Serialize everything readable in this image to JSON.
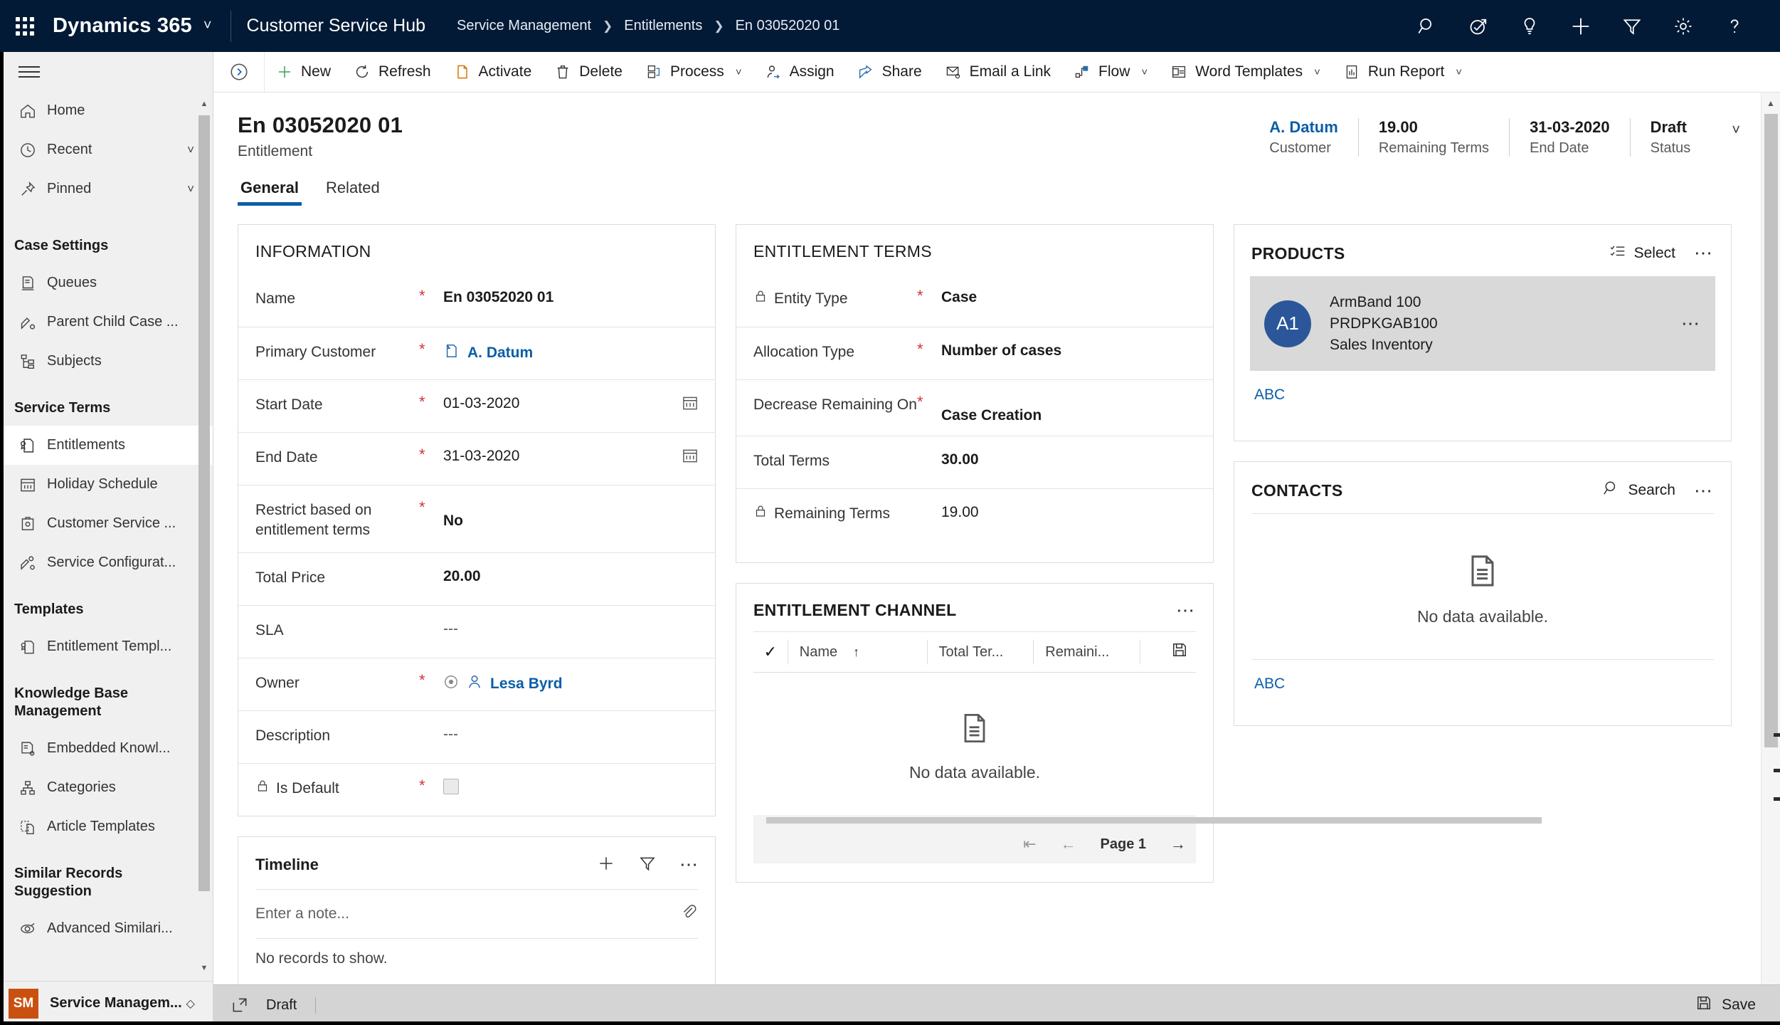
{
  "topbar": {
    "waffle": "app-launcher",
    "brand": "Dynamics 365",
    "app_title": "Customer Service Hub",
    "breadcrumb": [
      "Service Management",
      "Entitlements",
      "En 03052020 01"
    ],
    "icons": [
      "search-icon",
      "assistant-icon",
      "lightbulb-icon",
      "plus-icon",
      "filter-icon",
      "gear-icon",
      "help-icon"
    ],
    "brand_bg": "#021A36"
  },
  "sidebar": {
    "top_items": [
      {
        "label": "Home",
        "icon": "home-icon",
        "chevron": false
      },
      {
        "label": "Recent",
        "icon": "clock-icon",
        "chevron": true
      },
      {
        "label": "Pinned",
        "icon": "pin-icon",
        "chevron": true
      }
    ],
    "groups": [
      {
        "title": "Case Settings",
        "items": [
          {
            "label": "Queues",
            "icon": "queue-icon"
          },
          {
            "label": "Parent Child Case ...",
            "icon": "parent-child-case-icon"
          },
          {
            "label": "Subjects",
            "icon": "subjects-icon"
          }
        ]
      },
      {
        "title": "Service Terms",
        "items": [
          {
            "label": "Entitlements",
            "icon": "entitlement-icon",
            "active": true
          },
          {
            "label": "Holiday Schedule",
            "icon": "calendar-icon"
          },
          {
            "label": "Customer Service ...",
            "icon": "customer-service-icon"
          },
          {
            "label": "Service Configurat...",
            "icon": "service-config-icon"
          }
        ]
      },
      {
        "title": "Templates",
        "items": [
          {
            "label": "Entitlement Templ...",
            "icon": "entitlement-template-icon"
          }
        ]
      },
      {
        "title": "Knowledge Base Management",
        "items": [
          {
            "label": "Embedded Knowl...",
            "icon": "embedded-knowledge-icon"
          },
          {
            "label": "Categories",
            "icon": "categories-icon"
          },
          {
            "label": "Article Templates",
            "icon": "article-template-icon"
          }
        ]
      },
      {
        "title": "Similar Records Suggestion",
        "items": [
          {
            "label": "Advanced Similari...",
            "icon": "advanced-similarity-icon"
          }
        ]
      }
    ],
    "footer": {
      "initials": "SM",
      "label": "Service Managem...",
      "avatar_color": "#ca5010"
    }
  },
  "commandbar": {
    "collapse": "collapse-chevron-icon",
    "items": [
      {
        "label": "New",
        "icon": "plus-icon",
        "chevron": false
      },
      {
        "label": "Refresh",
        "icon": "refresh-icon",
        "chevron": false
      },
      {
        "label": "Activate",
        "icon": "activate-icon",
        "chevron": false
      },
      {
        "label": "Delete",
        "icon": "trash-icon",
        "chevron": false
      },
      {
        "label": "Process",
        "icon": "process-icon",
        "chevron": true
      },
      {
        "label": "Assign",
        "icon": "assign-icon",
        "chevron": false
      },
      {
        "label": "Share",
        "icon": "share-icon",
        "chevron": false
      },
      {
        "label": "Email a Link",
        "icon": "email-link-icon",
        "chevron": false
      },
      {
        "label": "Flow",
        "icon": "flow-icon",
        "chevron": true
      },
      {
        "label": "Word Templates",
        "icon": "word-icon",
        "chevron": true
      },
      {
        "label": "Run Report",
        "icon": "report-icon",
        "chevron": true
      }
    ]
  },
  "record": {
    "title": "En 03052020 01",
    "subtitle": "Entitlement",
    "stats": [
      {
        "value": "A. Datum",
        "label": "Customer",
        "link": true
      },
      {
        "value": "19.00",
        "label": "Remaining Terms",
        "link": false
      },
      {
        "value": "31-03-2020",
        "label": "End Date",
        "link": false
      },
      {
        "value": "Draft",
        "label": "Status",
        "link": false
      }
    ],
    "tabs": [
      {
        "label": "General",
        "active": true
      },
      {
        "label": "Related",
        "active": false
      }
    ]
  },
  "information": {
    "title": "INFORMATION",
    "fields": [
      {
        "label": "Name",
        "required": true,
        "value": "En 03052020 01",
        "kind": "text",
        "lock": false
      },
      {
        "label": "Primary Customer",
        "required": true,
        "value": "A. Datum",
        "kind": "lookup",
        "lock": false
      },
      {
        "label": "Start Date",
        "required": true,
        "value": "01-03-2020",
        "kind": "date",
        "lock": false
      },
      {
        "label": "End Date",
        "required": true,
        "value": "31-03-2020",
        "kind": "date",
        "lock": false
      },
      {
        "label": "Restrict based on entitlement terms",
        "required": true,
        "value": "No",
        "kind": "text",
        "lock": false
      },
      {
        "label": "Total Price",
        "required": false,
        "value": "20.00",
        "kind": "text",
        "lock": false
      },
      {
        "label": "SLA",
        "required": false,
        "value": "---",
        "kind": "muted",
        "lock": false
      },
      {
        "label": "Owner",
        "required": true,
        "value": "Lesa Byrd",
        "kind": "owner",
        "lock": false
      },
      {
        "label": "Description",
        "required": false,
        "value": "---",
        "kind": "muted",
        "lock": false
      },
      {
        "label": "Is Default",
        "required": true,
        "value": "",
        "kind": "checkbox",
        "lock": true
      }
    ]
  },
  "entitlement_terms": {
    "title": "ENTITLEMENT TERMS",
    "fields": [
      {
        "label": "Entity Type",
        "required": true,
        "value": "Case",
        "lock": true
      },
      {
        "label": "Allocation Type",
        "required": true,
        "value": "Number of cases",
        "lock": false
      },
      {
        "label": "Decrease Remaining On",
        "required": true,
        "value": "Case Creation",
        "lock": false
      },
      {
        "label": "Total Terms",
        "required": false,
        "value": "30.00",
        "lock": false
      },
      {
        "label": "Remaining Terms",
        "required": false,
        "value": "19.00",
        "lock": true
      }
    ]
  },
  "entitlement_channel": {
    "title": "ENTITLEMENT CHANNEL",
    "more": "more-commands",
    "columns": [
      "Name",
      "Total Ter...",
      "Remaini..."
    ],
    "sort_indicator": "↑",
    "empty_text": "No data available.",
    "pager": {
      "page_label": "Page 1"
    }
  },
  "products": {
    "title": "PRODUCTS",
    "select_label": "Select",
    "items": [
      {
        "initials": "A1",
        "name": "ArmBand 100",
        "code": "PRDPKGAB100",
        "category": "Sales Inventory"
      }
    ],
    "footer_link": "ABC"
  },
  "contacts": {
    "title": "CONTACTS",
    "search_label": "Search",
    "empty_text": "No data available.",
    "footer_link": "ABC"
  },
  "timeline": {
    "title": "Timeline",
    "note_placeholder": "Enter a note...",
    "empty_text": "No records to show."
  },
  "statusbar": {
    "status": "Draft",
    "save_label": "Save"
  }
}
